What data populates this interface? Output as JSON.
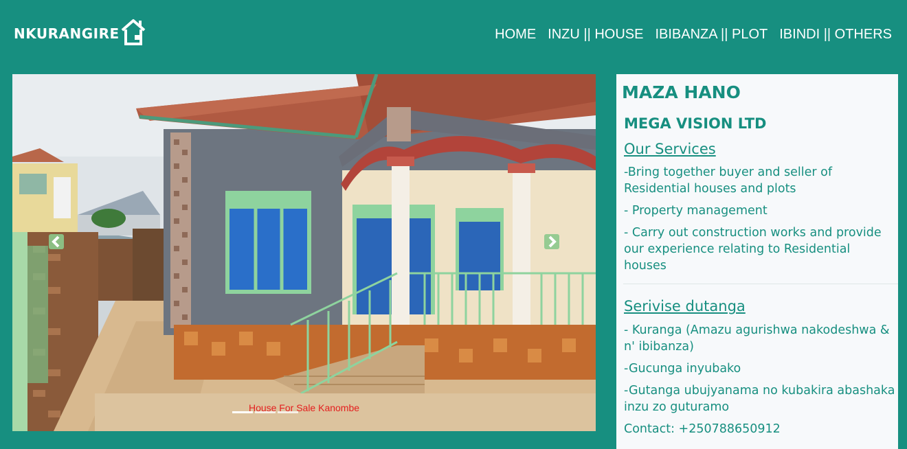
{
  "header": {
    "logo_text": "NKURANGIRE",
    "nav": [
      {
        "label": "HOME"
      },
      {
        "label": "INZU || HOUSE"
      },
      {
        "label": "IBIBANZA || PLOT"
      },
      {
        "label": "IBINDI || OTHERS"
      }
    ]
  },
  "carousel": {
    "caption": "House For Sale Kanombe",
    "active_slide": 1,
    "slide_count": 3
  },
  "panel": {
    "marquee": "MAZA HANO",
    "company": "MEGA VISION LTD",
    "services_title": "Our Services",
    "services": [
      "-Bring together buyer and seller of Residential houses and plots",
      "- Property management",
      "- Carry out construction works and provide our experience relating to Residential houses"
    ],
    "serivise_title": "Serivise dutanga",
    "serivise": [
      "- Kuranga (Amazu agurishwa nakodeshwa & n' ibibanza)",
      "-Gucunga inyubako",
      "-Gutanga ubujyanama no kubakira abashaka inzu zo guturamo"
    ],
    "contact": "Contact: +250788650912"
  },
  "colors": {
    "brand": "#178f80",
    "panel_bg": "#f7f9fb",
    "caption": "#e41e1e"
  }
}
